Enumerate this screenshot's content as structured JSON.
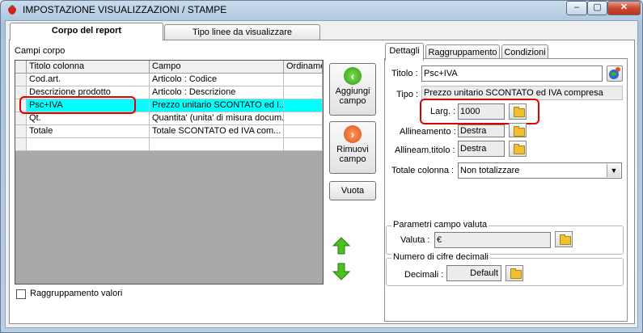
{
  "window": {
    "title": "IMPOSTAZIONE VISUALIZZAZIONI / STAMPE",
    "minimize": "–",
    "maximize": "▢",
    "close": "✕"
  },
  "main_tabs": [
    "Corpo del report",
    "Tipo linee da visualizzare"
  ],
  "grid": {
    "caption": "Campi corpo",
    "columns": [
      "Titolo colonna",
      "Campo",
      "Ordinamento"
    ],
    "rows": [
      {
        "titolo": "Cod.art.",
        "campo": "Articolo : Codice",
        "ordinamento": ""
      },
      {
        "titolo": "Descrizione prodotto",
        "campo": "Articolo : Descrizione",
        "ordinamento": ""
      },
      {
        "titolo": "Psc+IVA",
        "campo": "Prezzo unitario SCONTATO ed I...",
        "ordinamento": ""
      },
      {
        "titolo": "Qt.",
        "campo": "Quantita' (unita' di misura docum...",
        "ordinamento": ""
      },
      {
        "titolo": "Totale",
        "campo": "Totale SCONTATO ed IVA com...",
        "ordinamento": ""
      },
      {
        "titolo": "",
        "campo": "",
        "ordinamento": ""
      }
    ],
    "selected_row": 2
  },
  "actions": {
    "add_label_1": "Aggiungi",
    "add_label_2": "campo",
    "remove_label_1": "Rimuovi",
    "remove_label_2": "campo",
    "empty_label": "Vuota"
  },
  "grouping_checkbox": {
    "label": "Raggruppamento valori",
    "checked": false
  },
  "detail_tabs": [
    "Dettagli",
    "Raggruppamento",
    "Condizioni"
  ],
  "details": {
    "titolo_label": "Titolo :",
    "titolo_value": "Psc+IVA",
    "tipo_label": "Tipo :",
    "tipo_value": "Prezzo unitario SCONTATO ed IVA compresa",
    "larg_label": "Larg. :",
    "larg_value": "1000",
    "allineamento_label": "Allineamento :",
    "allineamento_value": "Destra",
    "allineam_titolo_label": "Allineam.titolo :",
    "allineam_titolo_value": "Destra",
    "totale_label": "Totale colonna :",
    "totale_value": "Non totalizzare",
    "valuta_group": "Parametri campo valuta",
    "valuta_label": "Valuta :",
    "valuta_value": "€",
    "decimali_group": "Numero di cifre decimali",
    "decimali_label": "Decimali :",
    "decimali_value": "Default"
  },
  "colors": {
    "selection": "#00ffff",
    "highlight": "#e00000",
    "grid_background": "#a9a9a9"
  }
}
